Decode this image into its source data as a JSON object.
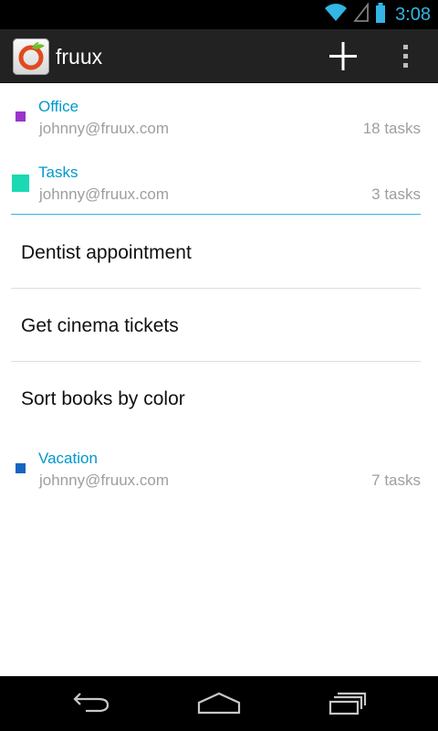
{
  "status_bar": {
    "time": "3:08",
    "icons": [
      "wifi-icon",
      "signal-icon",
      "battery-icon"
    ],
    "accent_color": "#33b5e5"
  },
  "action_bar": {
    "title": "fruux",
    "app_icon": "fruux-logo-icon",
    "actions": [
      "add-icon",
      "overflow-menu-icon"
    ],
    "background": "#222222"
  },
  "calendars": [
    {
      "name": "Office",
      "account": "johnny@fruux.com",
      "count": "18 tasks",
      "color": "#9933cc",
      "expanded": false,
      "tasks": []
    },
    {
      "name": "Tasks",
      "account": "johnny@fruux.com",
      "count": "3 tasks",
      "color": "#1ad9b3",
      "expanded": true,
      "tasks": [
        {
          "title": "Dentist appointment"
        },
        {
          "title": "Get cinema tickets"
        },
        {
          "title": "Sort books by color"
        }
      ]
    },
    {
      "name": "Vacation",
      "account": "johnny@fruux.com",
      "count": "7 tasks",
      "color": "#1565c0",
      "expanded": false,
      "tasks": []
    }
  ],
  "theme": {
    "calendar_name_color": "#0099cc",
    "secondary_text_color": "#9e9e9e",
    "divider_color": "#dedede"
  },
  "nav_bar": {
    "buttons": [
      "back-icon",
      "home-icon",
      "recent-apps-icon"
    ]
  }
}
